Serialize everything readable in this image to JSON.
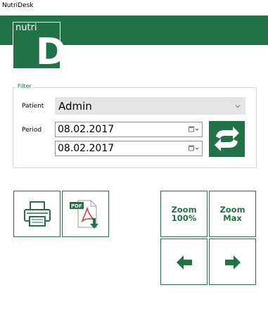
{
  "window": {
    "title": "NutriDesk"
  },
  "logo": {
    "text": "nutri",
    "letter": "D"
  },
  "filter": {
    "legend": "Filter",
    "patient_label": "Patient",
    "patient_value": "Admin",
    "period_label": "Period",
    "date_from": "08.02.2017",
    "date_to": "08.02.2017"
  },
  "toolbar": {
    "zoom100_label_1": "Zoom",
    "zoom100_label_2": "100%",
    "zoommax_label_1": "Zoom",
    "zoommax_label_2": "Max",
    "pdf_badge": "PDF"
  },
  "colors": {
    "accent": "#217346",
    "field_bg": "#e5e5e5",
    "border": "#d8d8d8"
  },
  "icons": [
    "printer-icon",
    "pdf-download-icon",
    "refresh-icon",
    "arrow-left-icon",
    "arrow-right-icon",
    "calendar-icon",
    "chevron-down-icon"
  ]
}
